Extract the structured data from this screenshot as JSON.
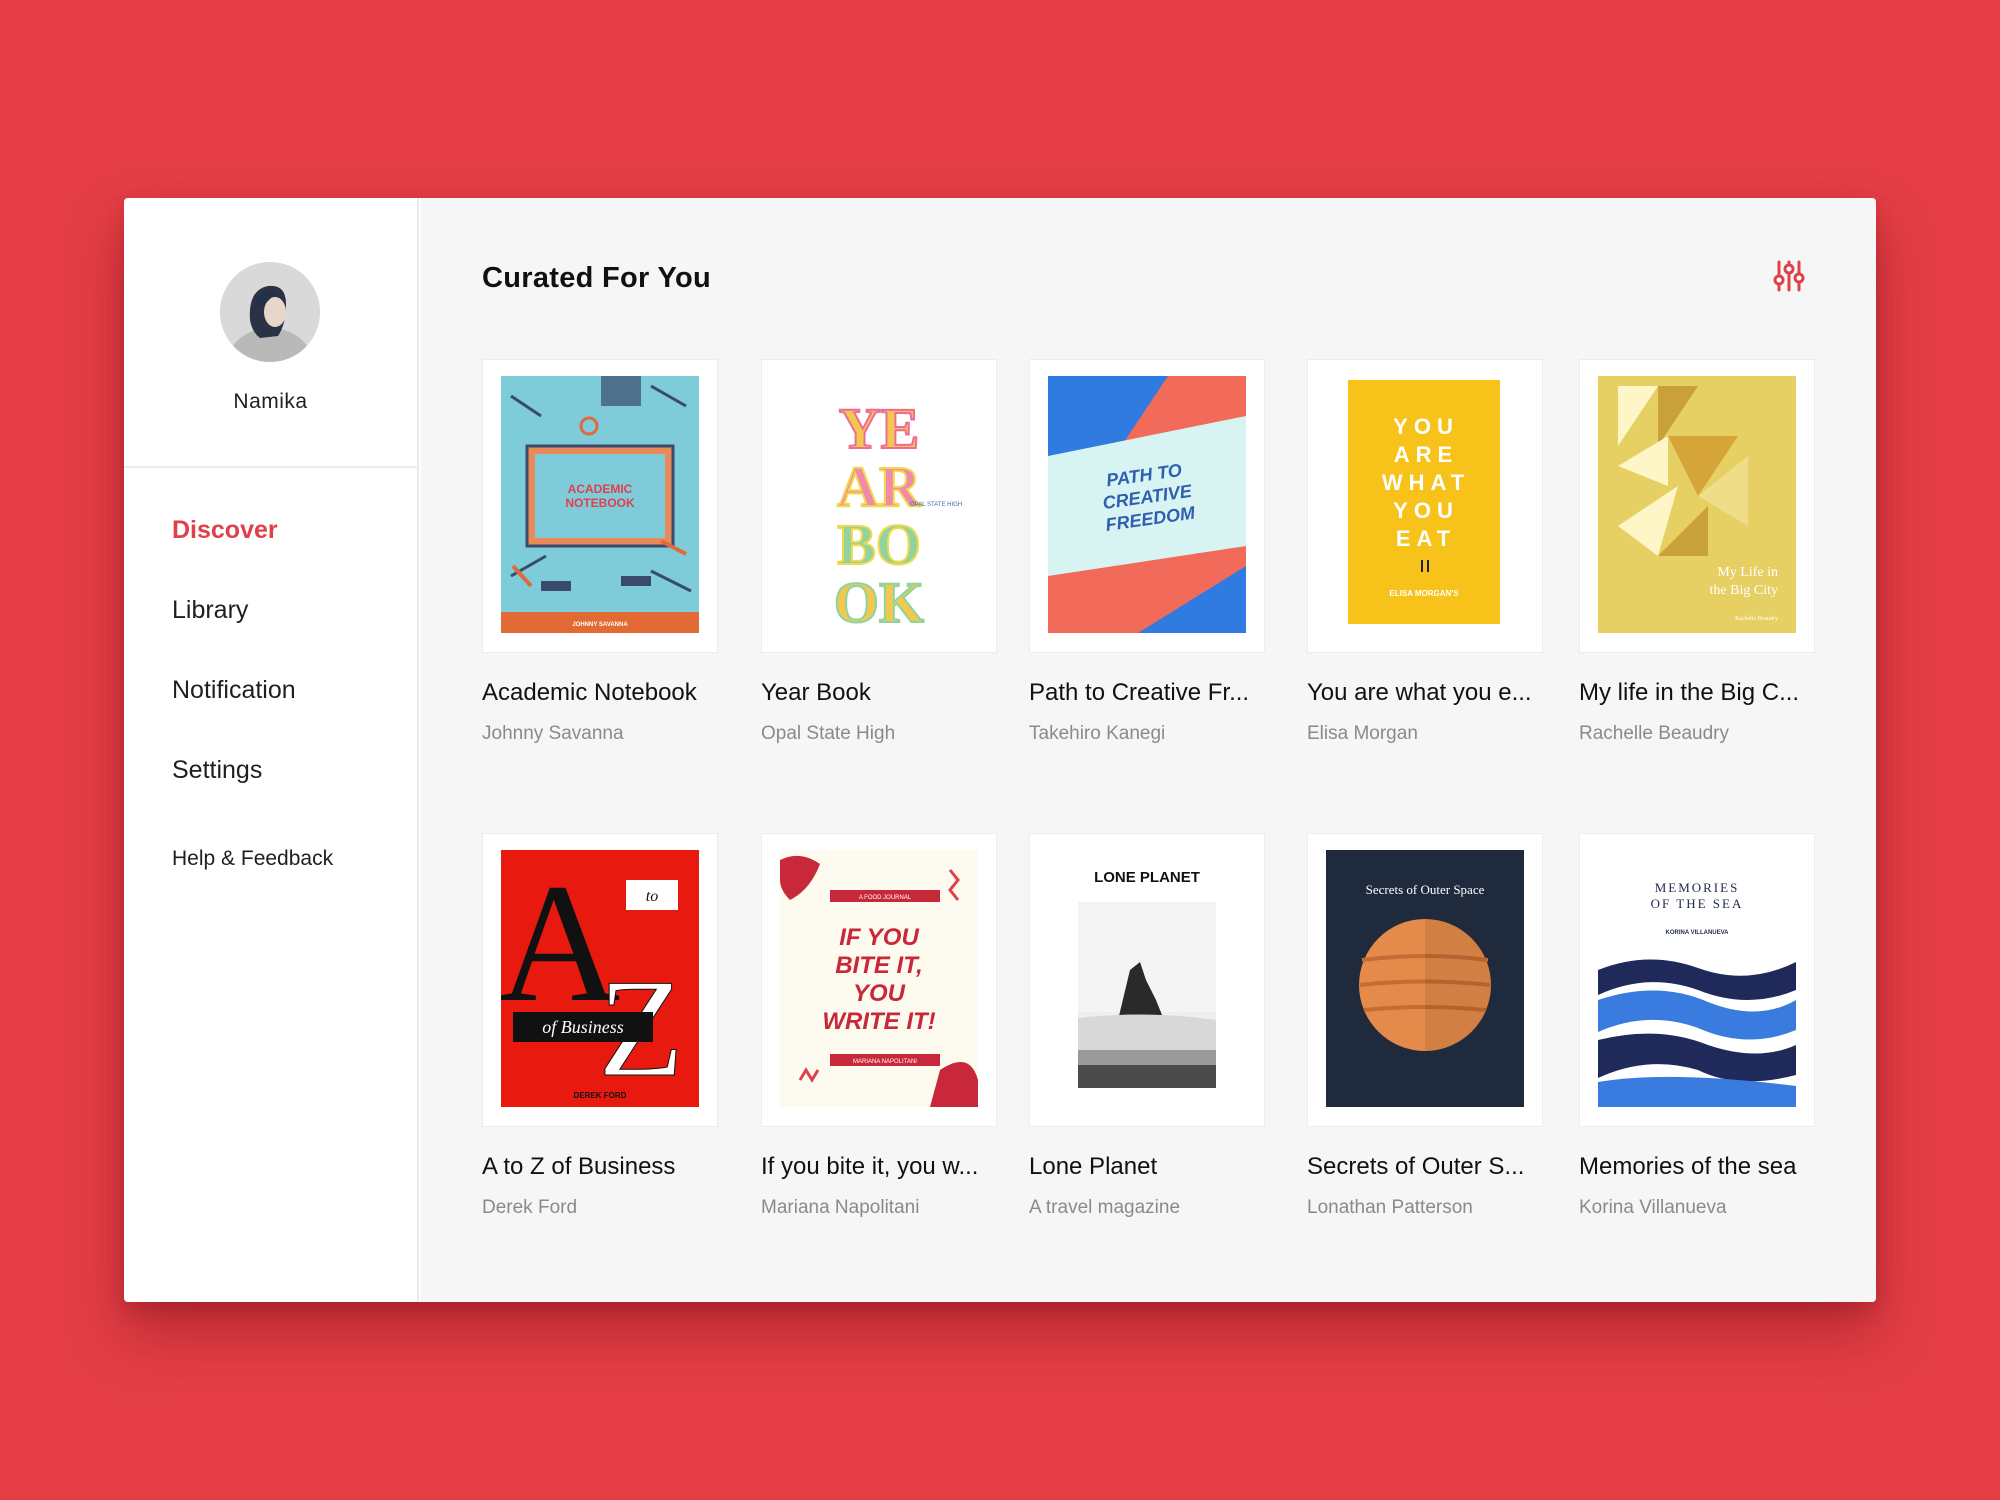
{
  "profile": {
    "name": "Namika"
  },
  "nav": [
    {
      "label": "Discover",
      "active": true
    },
    {
      "label": "Library"
    },
    {
      "label": "Notification"
    },
    {
      "label": "Settings"
    },
    {
      "label": "Help & Feedback"
    }
  ],
  "main": {
    "title": "Curated For You",
    "accent_color": "#e0404a"
  },
  "books": [
    {
      "title": "Academic Notebook",
      "author": "Johnny Savanna",
      "cover": {
        "lines": [
          "ACADEMIC",
          "NOTEBOOK"
        ],
        "footer": "JOHNNY SAVANNA"
      }
    },
    {
      "title": "Year Book",
      "author": "Opal State High",
      "cover": {
        "lines": [
          "YE",
          "AR",
          "BO",
          "OK"
        ],
        "small": "OPAL STATE HIGH"
      }
    },
    {
      "title": "Path to Creative Fr...",
      "author": "Takehiro Kanegi",
      "cover": {
        "lines": [
          "PATH TO",
          "CREATIVE",
          "FREEDOM"
        ]
      }
    },
    {
      "title": "You are what you e...",
      "author": "Elisa Morgan",
      "cover": {
        "lines": [
          "YOU",
          "ARE",
          "WHAT",
          "YOU",
          "EAT"
        ],
        "footer": "ELISA MORGAN'S"
      }
    },
    {
      "title": "My life in the Big C...",
      "author": "Rachelle Beaudry",
      "cover": {
        "lines": [
          "My Life in",
          "the Big City"
        ],
        "footer": "Rachelle Beaudry"
      }
    },
    {
      "title": "A to Z of Business",
      "author": "Derek Ford",
      "cover": {
        "lines": [
          "A",
          "to",
          "Z",
          "of Business"
        ],
        "footer": "DEREK FORD"
      }
    },
    {
      "title": "If you bite it, you w...",
      "author": "Mariana Napolitani",
      "cover": {
        "lines": [
          "IF YOU",
          "BITE IT,",
          "YOU",
          "WRITE IT!"
        ],
        "small": "A FOOD JOURNAL",
        "footer": "MARIANA NAPOLITANI"
      }
    },
    {
      "title": "Lone Planet",
      "author": "A travel magazine",
      "cover": {
        "lines": [
          "LONE PLANET"
        ]
      }
    },
    {
      "title": "Secrets of Outer S...",
      "author": "Lonathan Patterson",
      "cover": {
        "lines": [
          "Secrets of Outer Space"
        ]
      }
    },
    {
      "title": "Memories of the sea",
      "author": "Korina Villanueva",
      "cover": {
        "lines": [
          "MEMORIES",
          "OF THE SEA"
        ],
        "footer": "KORINA VILLANUEVA"
      }
    }
  ]
}
